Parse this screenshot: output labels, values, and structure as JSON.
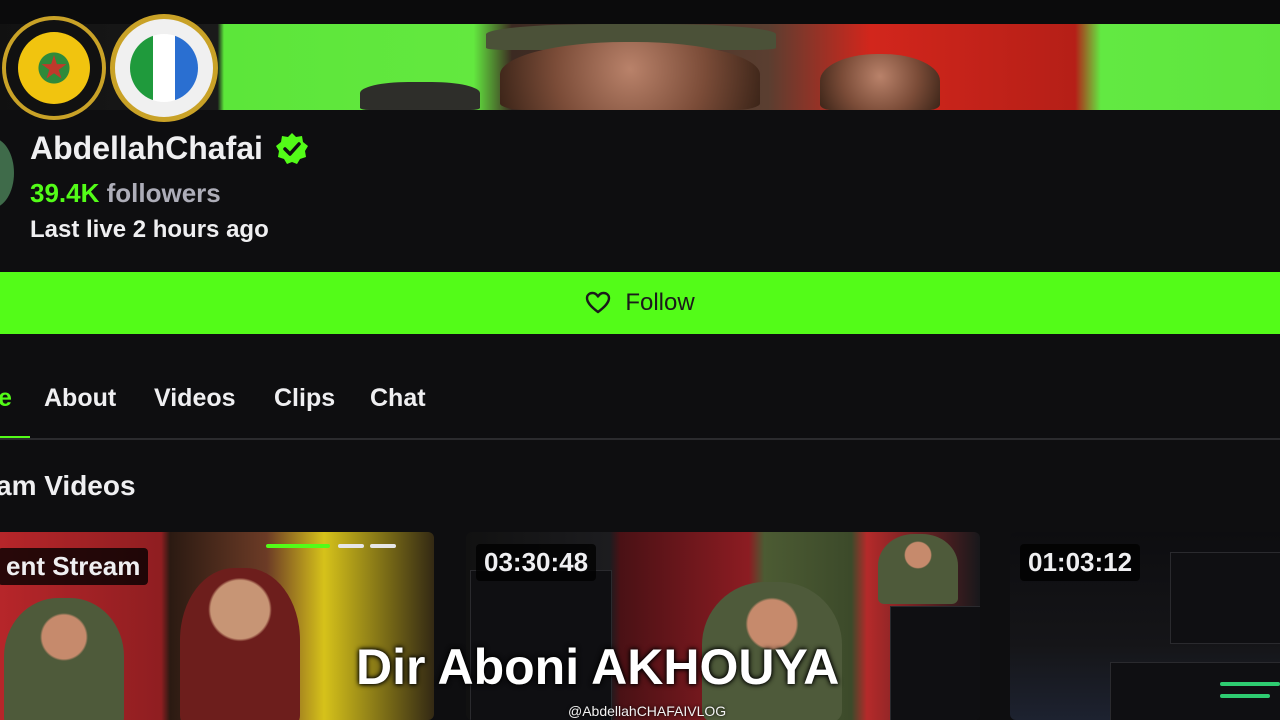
{
  "banner": {
    "emblem_left": "Forces Armées Royales emblem",
    "emblem_right": "Ministério da Defesa emblem"
  },
  "channel": {
    "name": "AbdellahChafai",
    "verified_icon": "verified-badge-icon",
    "followers_count": "39.4K",
    "followers_label": "followers",
    "last_live": "Last live 2 hours ago"
  },
  "follow": {
    "icon": "heart-icon",
    "label": "Follow"
  },
  "tabs": [
    {
      "label": "e",
      "active": true
    },
    {
      "label": "About",
      "active": false
    },
    {
      "label": "Videos",
      "active": false
    },
    {
      "label": "Clips",
      "active": false
    },
    {
      "label": "Chat",
      "active": false
    }
  ],
  "section": {
    "title": "am Videos"
  },
  "videos": [
    {
      "badge": "ent Stream"
    },
    {
      "badge": "03:30:48"
    },
    {
      "badge": "01:03:12"
    }
  ],
  "overlay": {
    "caption": "Dir Aboni  AKHOUYA",
    "watermark": "@AbdellahCHAFAIVLOG"
  },
  "colors": {
    "accent": "#53fc18",
    "background": "#0e0e10",
    "text": "#efeff1",
    "muted": "#adadb8"
  }
}
